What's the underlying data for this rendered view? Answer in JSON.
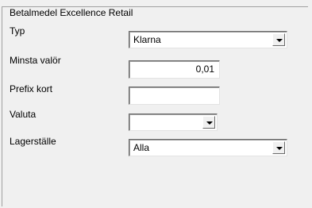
{
  "group": {
    "title": "Betalmedel Excellence Retail"
  },
  "fields": {
    "typ": {
      "label": "Typ",
      "value": "Klarna"
    },
    "minsta_valor": {
      "label": "Minsta valör",
      "value": "0,01"
    },
    "prefix_kort": {
      "label": "Prefix kort",
      "value": ""
    },
    "valuta": {
      "label": "Valuta",
      "value": ""
    },
    "lagerstalle": {
      "label": "Lagerställe",
      "value": "Alla"
    }
  },
  "icons": {
    "dropdown": "chevron-down-icon"
  }
}
